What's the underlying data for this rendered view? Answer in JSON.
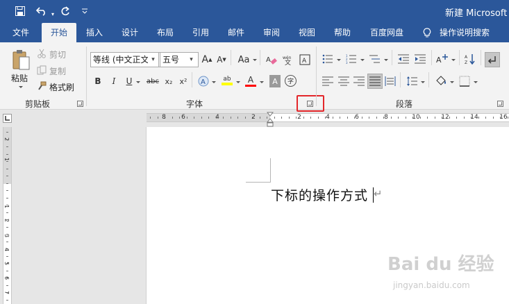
{
  "title_bar": {
    "doc_title": "新建 Microsoft W"
  },
  "quick_access": {
    "save_icon": "save-icon",
    "undo_icon": "undo-icon",
    "redo_icon": "redo-icon",
    "customize_icon": "customize-arrow-icon"
  },
  "menu_tabs": [
    "文件",
    "开始",
    "插入",
    "设计",
    "布局",
    "引用",
    "邮件",
    "审阅",
    "视图",
    "帮助",
    "百度网盘"
  ],
  "active_tab": "开始",
  "tell_me": "操作说明搜索",
  "clipboard": {
    "paste": "粘贴",
    "cut": "剪切",
    "copy": "复制",
    "format_painter": "格式刷",
    "group_label": "剪贴板"
  },
  "font": {
    "font_name": "等线 (中文正文",
    "font_size": "五号",
    "grow": "A",
    "shrink": "A",
    "case_label": "Aa",
    "bold": "B",
    "italic": "I",
    "underline": "U",
    "strike": "abc",
    "subscript": "x₂",
    "superscript": "x²",
    "highlight_text": "ab",
    "font_color_text": "A",
    "char_shading": "A",
    "enclose_char": "字",
    "group_label": "字体"
  },
  "paragraph": {
    "group_label": "段落"
  },
  "colors": {
    "brand": "#2b579a",
    "highlight_yellow": "#ffff00",
    "font_red": "#ff0000",
    "annotation_red": "#e3262a"
  },
  "ruler": {
    "left_numbers": [
      "8",
      "6",
      "4",
      "2"
    ],
    "right_numbers": [
      "2",
      "4",
      "6",
      "8",
      "10",
      "12",
      "14",
      "16"
    ],
    "vertical_numbers": [
      "2",
      "1",
      "1",
      "2",
      "3",
      "4",
      "5",
      "6",
      "7",
      "8"
    ]
  },
  "document": {
    "text": "下标的操作方式",
    "paragraph_mark": "↵"
  },
  "watermark": {
    "brand": "Bai du 经验",
    "url": "jingyan.baidu.com"
  }
}
